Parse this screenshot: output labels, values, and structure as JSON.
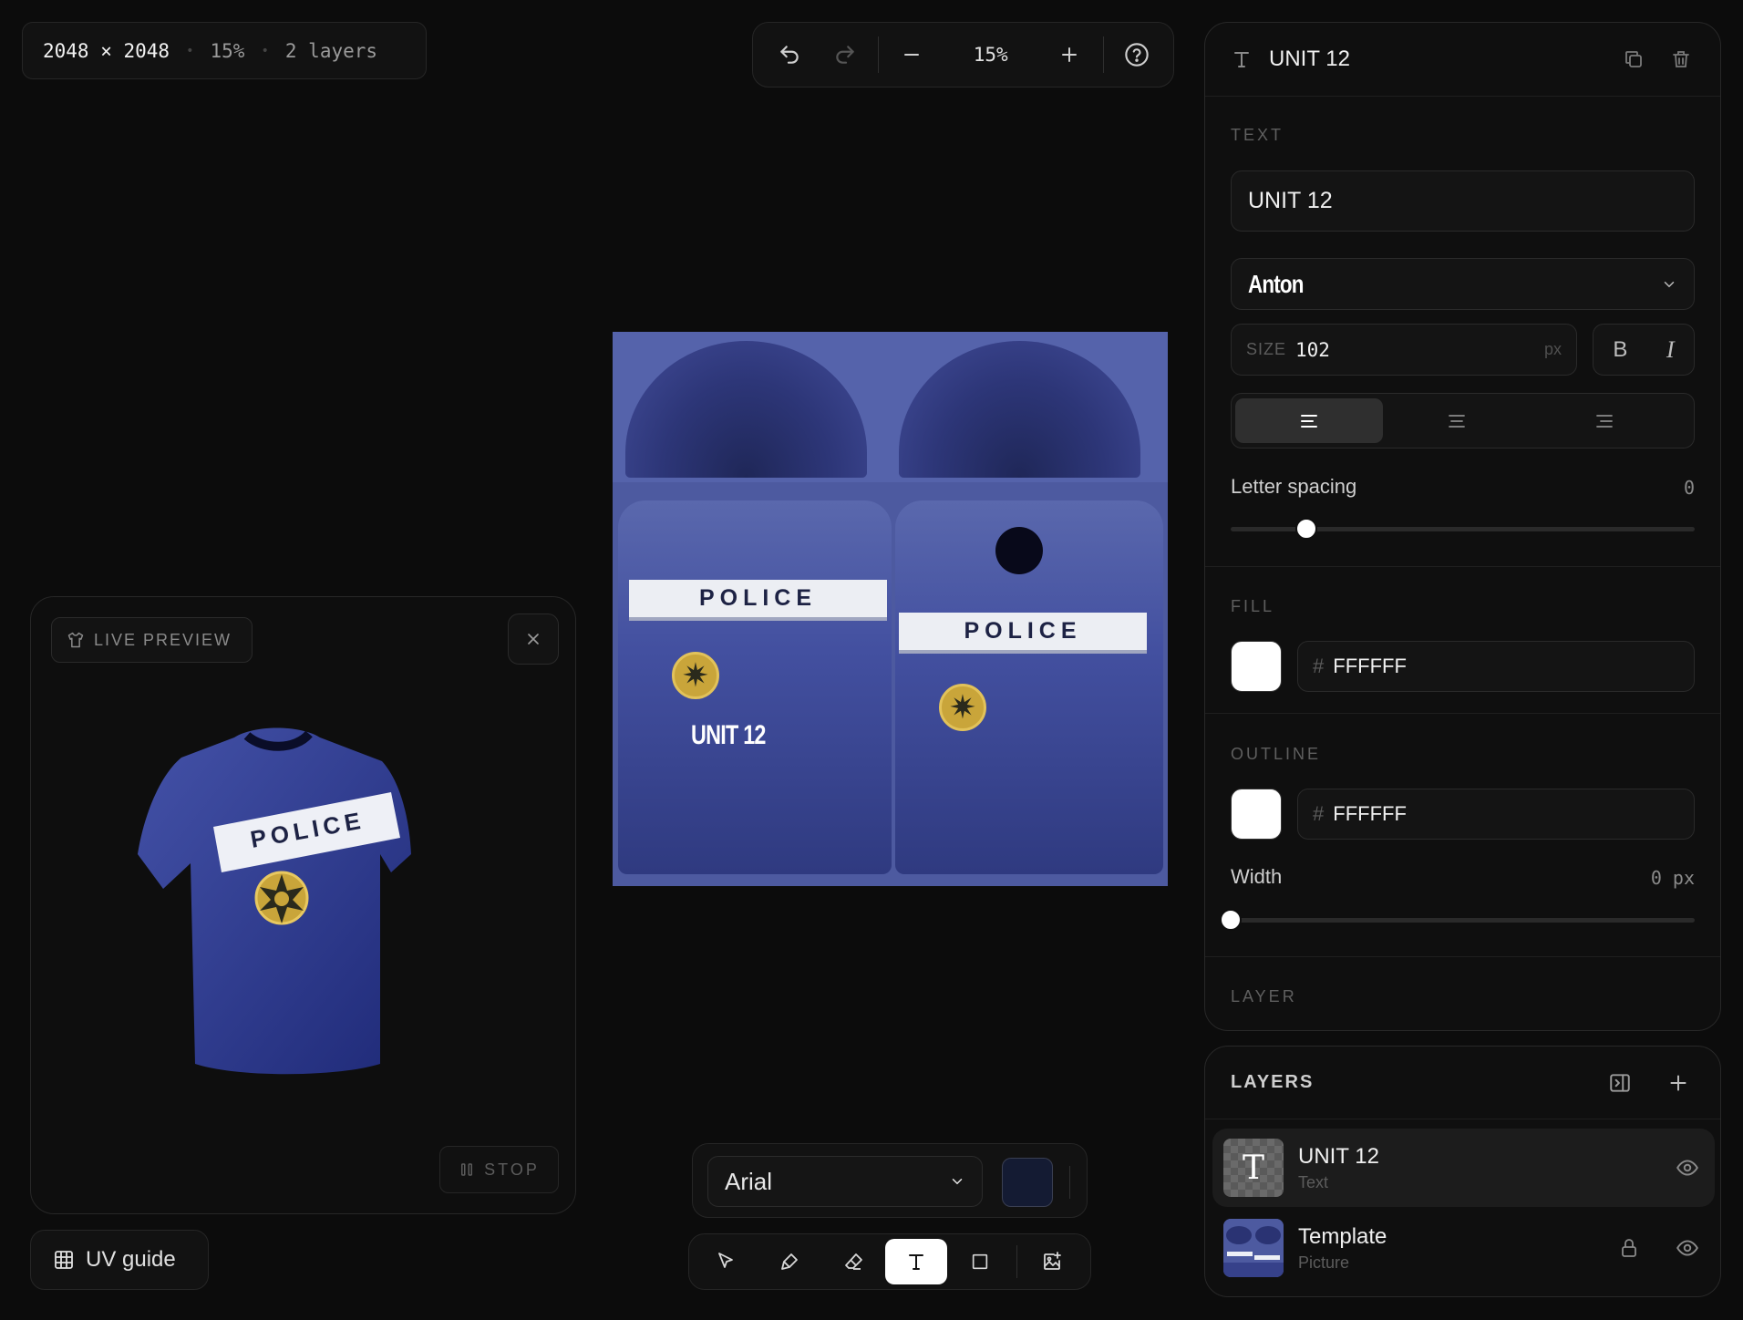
{
  "status": {
    "dimensions": "2048 × 2048",
    "zoom": "15%",
    "layers": "2 layers"
  },
  "zoombar": {
    "zoom": "15%"
  },
  "canvas": {
    "stripe_left": "POLICE",
    "stripe_right": "POLICE",
    "overlay_text": "UNIT 12",
    "star_glyph": "✷"
  },
  "preview": {
    "badge": "LIVE PREVIEW",
    "stop": "STOP",
    "shirt_text": "POLICE"
  },
  "uv_guide": "UV guide",
  "fontbar": {
    "font": "Arial",
    "color": "#141b33"
  },
  "props": {
    "title": "UNIT 12",
    "text_label": "TEXT",
    "text_value": "UNIT 12",
    "font": "Anton",
    "size_label": "SIZE",
    "size_value": "102",
    "size_unit": "px",
    "bold": "B",
    "italic": "I",
    "letter_spacing_label": "Letter spacing",
    "letter_spacing_value": "0",
    "fill_label": "FILL",
    "fill_hash": "#",
    "fill_value": "FFFFFF",
    "outline_label": "OUTLINE",
    "outline_hash": "#",
    "outline_value": "FFFFFF",
    "width_label": "Width",
    "width_value": "0 px",
    "layer_label": "LAYER"
  },
  "layers": {
    "title": "LAYERS",
    "items": [
      {
        "name": "UNIT 12",
        "type": "Text",
        "thumb": "T"
      },
      {
        "name": "Template",
        "type": "Picture"
      }
    ]
  }
}
